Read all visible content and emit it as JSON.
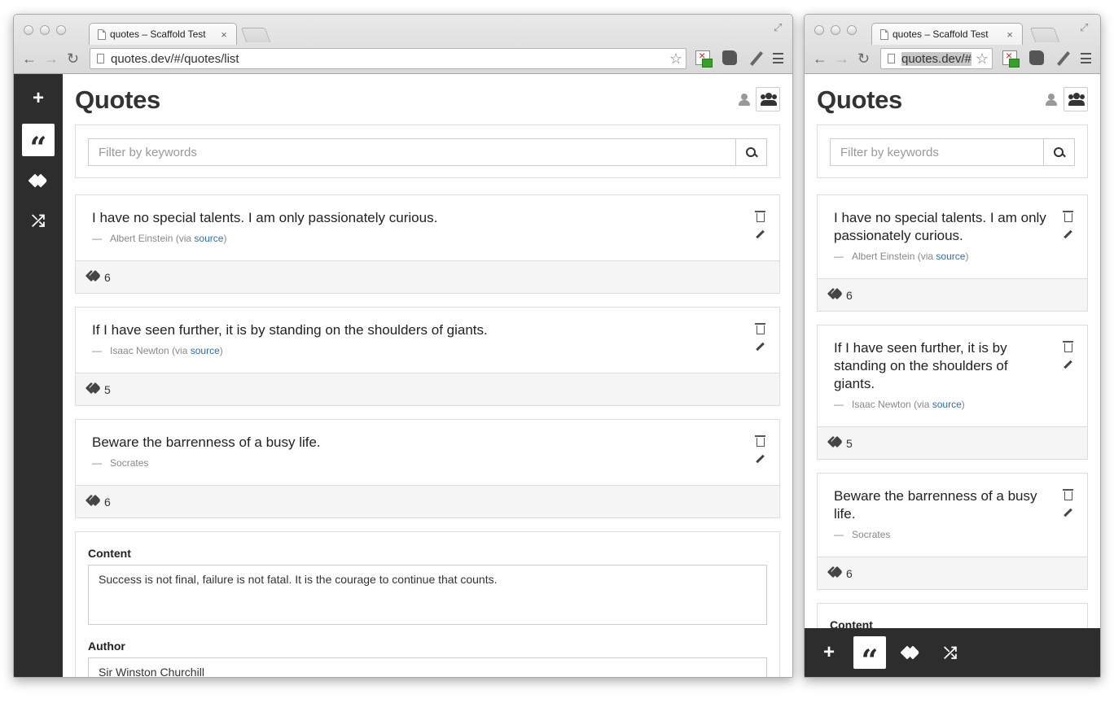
{
  "browser": {
    "tab_title": "quotes – Scaffold Test",
    "tab_close": "×",
    "url_wide": "quotes.dev/#/quotes/list",
    "url_narrow": "quotes.dev/#"
  },
  "sidebar": {
    "items": [
      {
        "icon": "plus-icon",
        "glyph": "+"
      },
      {
        "icon": "quote-icon",
        "glyph": "“",
        "active": true
      },
      {
        "icon": "tags-icon"
      },
      {
        "icon": "shuffle-icon",
        "glyph": "⤮"
      }
    ]
  },
  "page": {
    "title": "Quotes",
    "search_placeholder": "Filter by keywords"
  },
  "quotes": [
    {
      "text": "I have no special talents. I am only passionately curious.",
      "dash": "—",
      "author": "Albert Einstein",
      "via": "(via",
      "source": "source",
      "close": ")",
      "tags": "6"
    },
    {
      "text": "If I have seen further, it is by standing on the shoulders of giants.",
      "dash": "—",
      "author": "Isaac Newton",
      "via": "(via",
      "source": "source",
      "close": ")",
      "tags": "5"
    },
    {
      "text": "Beware the barrenness of a busy life.",
      "dash": "—",
      "author": "Socrates",
      "tags": "6"
    }
  ],
  "form": {
    "content_label": "Content",
    "content_value": "Success is not final, failure is not fatal. It is the courage to continue that counts.",
    "author_label": "Author",
    "author_value": "Sir Winston Churchill"
  },
  "colors": {
    "sidebar": "#2d2d2d",
    "link": "#2a6ebb",
    "footer": "#f5f5f5"
  }
}
